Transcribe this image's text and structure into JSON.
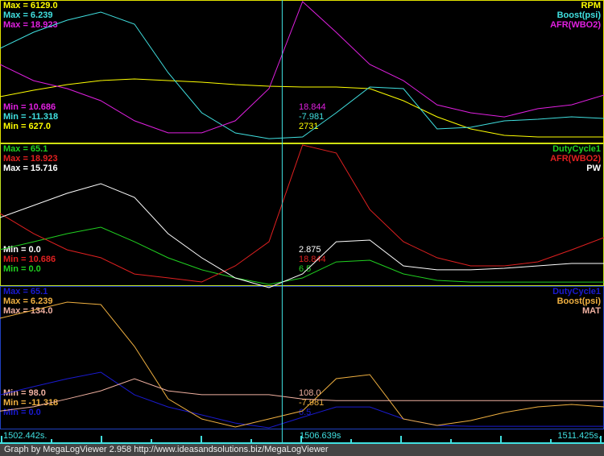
{
  "chart_data": [
    {
      "type": "line",
      "title": "Panel 1",
      "x_range": [
        1502.442,
        1511.425
      ],
      "x": [
        1502.442,
        1502.942,
        1503.442,
        1503.942,
        1504.442,
        1504.942,
        1505.442,
        1505.942,
        1506.442,
        1506.942,
        1507.442,
        1507.942,
        1508.442,
        1508.942,
        1509.442,
        1509.942,
        1510.442,
        1510.942,
        1511.425
      ],
      "series": [
        {
          "name": "RPM",
          "color": "#ffff00",
          "max_label": "Max = 6129.0",
          "min_label": "Min = 627.0",
          "cursor": "2731",
          "range": [
            627.0,
            6129.0
          ],
          "values": [
            2398,
            2651,
            2872,
            3030,
            3093,
            3030,
            2967,
            2872,
            2809,
            2777,
            2777,
            2714,
            2240,
            1608,
            1134,
            880,
            817,
            817,
            817
          ]
        },
        {
          "name": "Boost(psi)",
          "color": "#40e0e0",
          "max_label": "Max = 6.239",
          "min_label": "Min = -11.318",
          "cursor": "-7.981",
          "range": [
            -11.318,
            6.239
          ],
          "values": [
            0.39,
            2.4,
            3.92,
            4.93,
            3.41,
            -2.65,
            -7.69,
            -10.21,
            -10.92,
            -10.71,
            -7.69,
            -4.46,
            -4.66,
            -9.7,
            -9.5,
            -8.69,
            -8.49,
            -8.19,
            -8.39
          ]
        },
        {
          "name": "AFR(WBO2)",
          "color": "#e020e0",
          "max_label": "Max = 18.923",
          "min_label": "Min = 10.686",
          "cursor": "18.844",
          "range": [
            10.686,
            18.923
          ],
          "values": [
            15.23,
            14.28,
            13.81,
            13.1,
            11.92,
            11.21,
            11.21,
            11.92,
            13.81,
            19.5,
            17.12,
            15.23,
            14.28,
            12.86,
            12.39,
            12.15,
            12.63,
            12.86,
            13.43
          ]
        }
      ]
    },
    {
      "type": "line",
      "title": "Panel 2",
      "x_range": [
        1502.442,
        1511.425
      ],
      "series": [
        {
          "name": "DutyCycle1",
          "color": "#20d020",
          "max_label": "Max = 65.1",
          "min_label": "Min = 0.0",
          "cursor": "6.5",
          "range": [
            0,
            65.1
          ],
          "values": [
            16.2,
            19.9,
            23.7,
            26.7,
            19.9,
            12.4,
            6.8,
            3.0,
            0,
            3.0,
            10.5,
            11.3,
            4.9,
            1.9,
            1.1,
            1.1,
            1.1,
            1.1,
            1.1
          ]
        },
        {
          "name": "AFR(WBO2)",
          "color": "#e02020",
          "max_label": "Max = 18.923",
          "min_label": "Min = 10.686",
          "cursor": "18.844",
          "range": [
            10.686,
            18.923
          ],
          "values": [
            14.88,
            13.69,
            12.73,
            12.26,
            11.3,
            11.07,
            10.83,
            11.78,
            13.21,
            19.5,
            18.45,
            15.11,
            13.21,
            12.26,
            11.78,
            11.78,
            12.02,
            12.73,
            13.45
          ]
        },
        {
          "name": "PW",
          "color": "#ffffff",
          "max_label": "Max = 15.716",
          "min_label": "Min = 0.0",
          "cursor": "2.875",
          "range": [
            0,
            15.716
          ],
          "values": [
            7.54,
            8.9,
            10.27,
            11.36,
            9.81,
            5.72,
            3.0,
            0.73,
            -1,
            1.18,
            4.81,
            5.0,
            2.09,
            1.64,
            1.64,
            1.82,
            2.09,
            2.36,
            2.36
          ]
        }
      ]
    },
    {
      "type": "line",
      "title": "Panel 3",
      "x_range": [
        1502.442,
        1511.425
      ],
      "series": [
        {
          "name": "DutyCycle1",
          "color": "#1a1ad0",
          "max_label": "Max = 65.1",
          "min_label": "Min = 0.0",
          "cursor": "6.5",
          "range": [
            0,
            65.1
          ],
          "values": [
            15.3,
            19.1,
            22.8,
            25.8,
            15.3,
            9.7,
            6.0,
            2.2,
            0,
            4.9,
            9.7,
            9.7,
            4.1,
            1.1,
            0.7,
            0.7,
            0.7,
            0.7,
            0.7
          ]
        },
        {
          "name": "Boost(psi)",
          "color": "#f0b040",
          "max_label": "Max = 6.239",
          "min_label": "Min = -11.318",
          "cursor": "-7.981",
          "range": [
            -11.318,
            6.239
          ],
          "values": [
            2.4,
            3.41,
            4.42,
            4.12,
            -1.13,
            -7.69,
            -10.21,
            -11.22,
            -10.21,
            -9.2,
            -5.16,
            -4.66,
            -10.21,
            -11.02,
            -10.41,
            -9.4,
            -8.69,
            -8.39,
            -8.69
          ]
        },
        {
          "name": "MAT",
          "color": "#f0b0a0",
          "max_label": "Max = 134.0",
          "min_label": "Min = 98.0",
          "cursor": "108.0",
          "range": [
            98.0,
            134.0
          ],
          "values": [
            102.3,
            103.4,
            105.4,
            107.5,
            110.6,
            107.5,
            106.5,
            106.5,
            106.5,
            105.4,
            105.0,
            105.0,
            105.0,
            105.0,
            105.0,
            105.0,
            105.0,
            105.0,
            105.0
          ]
        }
      ]
    }
  ],
  "cursor_time": 1506.639,
  "axis": {
    "start": "1502.442s.",
    "cursor": "1506.639s",
    "end": "1511.425s."
  },
  "footer": "Graph by MegaLogViewer 2.958 http://www.ideasandsolutions.biz/MegaLogViewer"
}
